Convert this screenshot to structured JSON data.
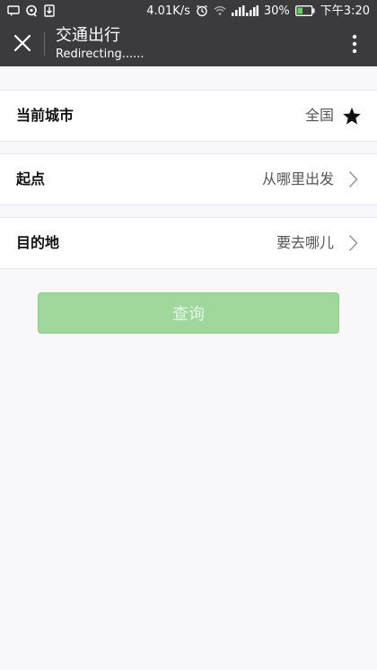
{
  "status_bar": {
    "speed": "4.01K/s",
    "battery": "30%",
    "time": "下午3:20",
    "icons": [
      "message-icon",
      "qq-icon",
      "download-icon",
      "alarm-icon",
      "wifi-icon",
      "signal-icon",
      "battery-icon"
    ]
  },
  "app_bar": {
    "title": "交通出行",
    "subtitle": "Redirecting......",
    "close_icon": "close-icon",
    "more_icon": "more-vertical-icon"
  },
  "form": {
    "rows": [
      {
        "label": "当前城市",
        "value": "全国",
        "icon": "star-icon"
      },
      {
        "label": "起点",
        "value": "从哪里出发",
        "icon": "chevron-right-icon"
      },
      {
        "label": "目的地",
        "value": "要去哪儿",
        "icon": "chevron-right-icon"
      }
    ],
    "query_button": "查询"
  },
  "colors": {
    "toolbar": "#3b3a3c",
    "background": "#f8f7f9",
    "button": "#9fd79d",
    "button_text": "#e7f5e6"
  }
}
